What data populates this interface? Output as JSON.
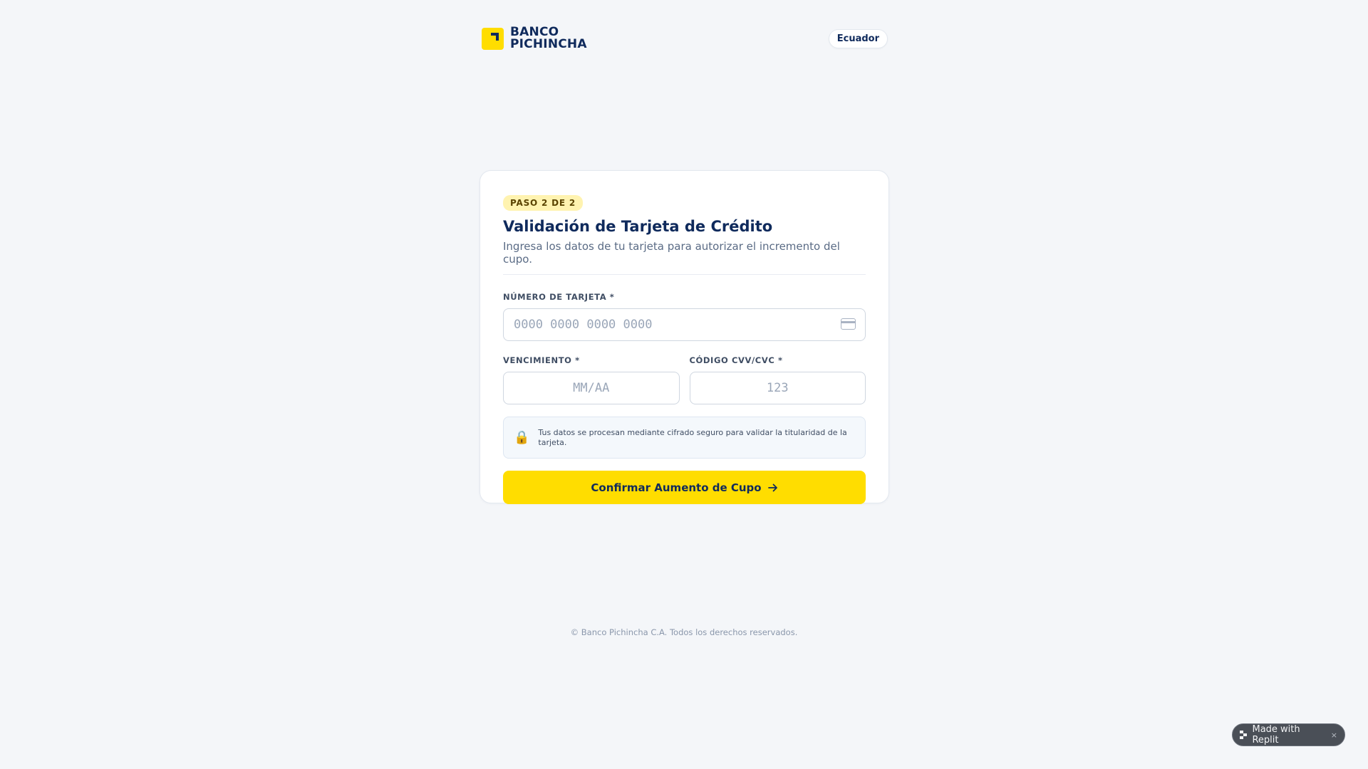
{
  "header": {
    "brand_line1": "BANCO",
    "brand_line2": "PICHINCHA",
    "country": "Ecuador"
  },
  "form": {
    "step_badge": "PASO 2 DE 2",
    "title": "Validación de Tarjeta de Crédito",
    "subtitle": "Ingresa los datos de tu tarjeta para autorizar el incremento del cupo.",
    "card_number": {
      "label": "NÚMERO DE TARJETA *",
      "value": "",
      "placeholder": "0000 0000 0000 0000",
      "icon": "credit-card-icon"
    },
    "expiry": {
      "label": "VENCIMIENTO *",
      "value": "",
      "placeholder": "MM/AA"
    },
    "cvv": {
      "label": "CÓDIGO CVV/CVC *",
      "value": "",
      "placeholder": "123"
    },
    "security_note": {
      "icon": "lock-icon",
      "text": "Tus datos se procesan mediante cifrado seguro para validar la titularidad de la tarjeta."
    },
    "submit_label": "Confirmar Aumento de Cupo"
  },
  "footer": {
    "copyright": "© Banco Pichincha C.A. Todos los derechos reservados."
  },
  "replit_badge": {
    "label": "Made with Replit",
    "close": "×"
  },
  "colors": {
    "brand_yellow": "#ffdd00",
    "brand_navy": "#0f2a5c",
    "background": "#f4f6f9"
  }
}
